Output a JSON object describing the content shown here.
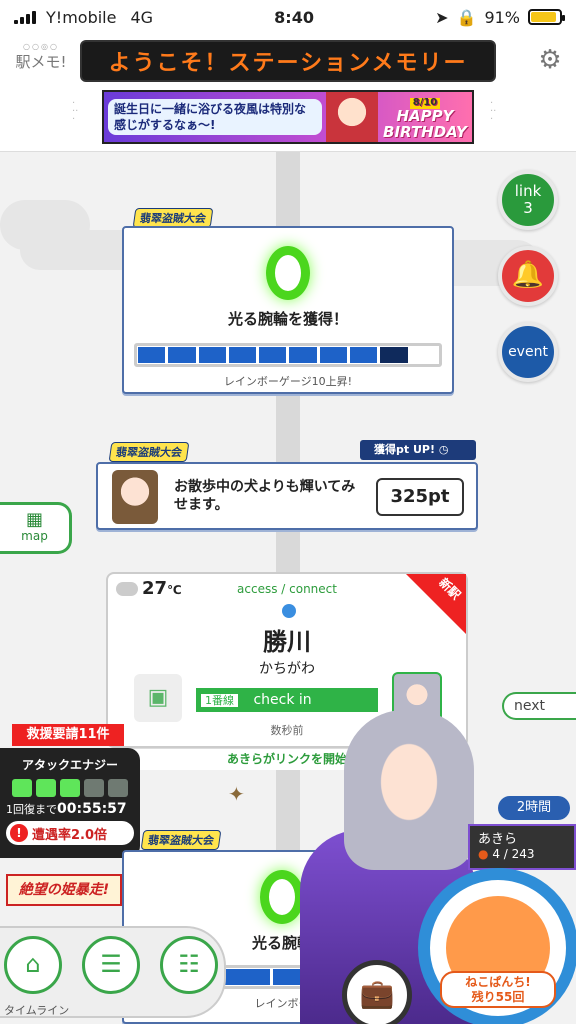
{
  "status_bar": {
    "carrier": "Y!mobile",
    "network": "4G",
    "time": "8:40",
    "battery_percent": "91%",
    "battery_level": 0.91
  },
  "header": {
    "logo_text": "駅メモ!",
    "marquee": "ようこそ！ステーションメモリー",
    "banner": {
      "text": "誕生日に一緒に浴びる夜風は特別な感じがするなぁ～!",
      "title": "HAPPY BIRTHDAY",
      "date": "8/10"
    }
  },
  "event_tag": "翡翠盗賊大会",
  "reward_card_1": {
    "reward": "光る腕輪を獲得！",
    "gauge_caption": "レインボーゲージ10上昇!",
    "gauge_fill": 0.9
  },
  "side_buttons": {
    "link_label": "link",
    "link_count": "3",
    "event_label": "event"
  },
  "points_card": {
    "badge": "獲得pt UP!",
    "quote": "お散歩中の犬よりも輝いてみせます。",
    "points": "325pt"
  },
  "map_tab": "map",
  "station": {
    "temperature": "27",
    "temp_unit": "℃",
    "access": "access / connect",
    "new_badge": "新駅",
    "name": "勝川",
    "kana": "かちがわ",
    "line": "1番線",
    "check_in": "check in",
    "ago": "数秒前",
    "footer": "あきらがリンクを開始"
  },
  "next_tab": "next",
  "rescue": "救援要請11件",
  "attack": {
    "title": "アタックエナジー",
    "energy_total": 5,
    "energy_filled": 3,
    "recover_label": "1回復まで",
    "recover_time": "00:55:57",
    "rate": "遭遇率2.0倍"
  },
  "event_banner_small": "絶望の姫暴走!",
  "reward_card_2": {
    "reward": "光る腕輪を獲得！",
    "gauge_caption": "レインボー"
  },
  "timeline_label": "タイムライン",
  "character": {
    "time_pill": "2時間",
    "name": "あきら",
    "count": "4 / 243"
  },
  "punch": {
    "line1": "ねこぱんち!",
    "line2": "残り55回"
  }
}
